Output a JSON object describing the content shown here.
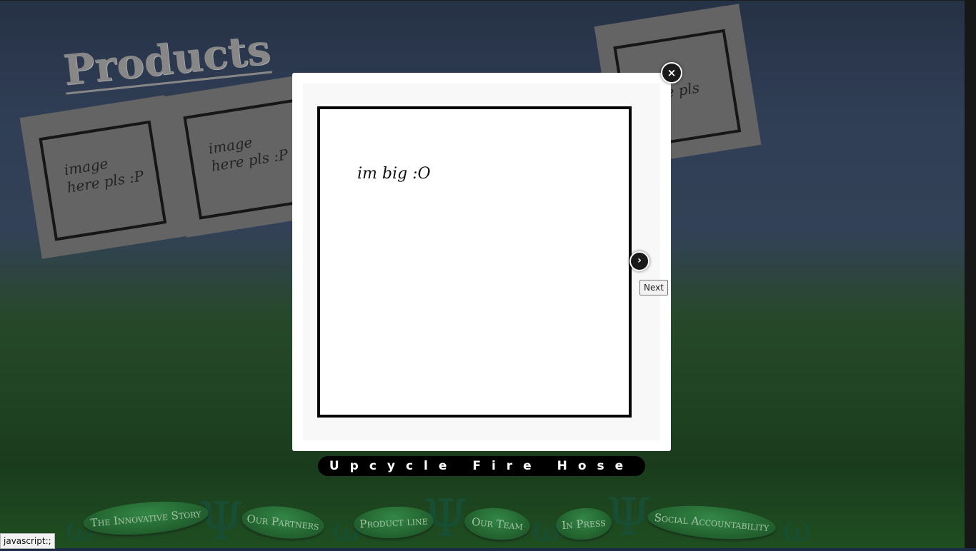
{
  "products_title": "Products",
  "tiles": [
    {
      "text": "image here pls :P"
    },
    {
      "text": "image here pls :P"
    },
    {
      "text": "image here pls"
    }
  ],
  "modal": {
    "big_text": "im big :O",
    "close_symbol": "×",
    "next_symbol": "›",
    "next_tooltip": "Next",
    "caption": "Upcycle Fire Hose"
  },
  "nav": {
    "items": [
      {
        "label": "The Innovative Story"
      },
      {
        "label": "Our Partners"
      },
      {
        "label": "Product line"
      },
      {
        "label": "Our Team"
      },
      {
        "label": "In Press"
      },
      {
        "label": "Social Accountability"
      }
    ],
    "psi_symbol": "Ψ",
    "omega_symbol": "ω"
  },
  "status_bar": "javascript:;"
}
